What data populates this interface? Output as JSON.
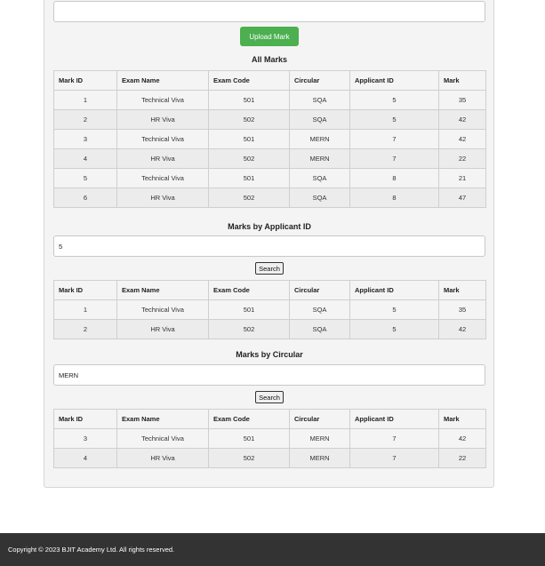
{
  "upload": {
    "button_label": "Upload Mark"
  },
  "columns": [
    "Mark ID",
    "Exam Name",
    "Exam Code",
    "Circular",
    "Applicant ID",
    "Mark"
  ],
  "all_marks": {
    "title": "All Marks",
    "rows": [
      [
        "1",
        "Technical Viva",
        "501",
        "SQA",
        "5",
        "35"
      ],
      [
        "2",
        "HR Viva",
        "502",
        "SQA",
        "5",
        "42"
      ],
      [
        "3",
        "Technical Viva",
        "501",
        "MERN",
        "7",
        "42"
      ],
      [
        "4",
        "HR Viva",
        "502",
        "MERN",
        "7",
        "22"
      ],
      [
        "5",
        "Technical Viva",
        "501",
        "SQA",
        "8",
        "21"
      ],
      [
        "6",
        "HR Viva",
        "502",
        "SQA",
        "8",
        "47"
      ]
    ]
  },
  "by_applicant": {
    "title": "Marks by Applicant ID",
    "input_value": "5",
    "search_label": "Search",
    "rows": [
      [
        "1",
        "Technical Viva",
        "501",
        "SQA",
        "5",
        "35"
      ],
      [
        "2",
        "HR Viva",
        "502",
        "SQA",
        "5",
        "42"
      ]
    ]
  },
  "by_circular": {
    "title": "Marks by Circular",
    "input_value": "MERN",
    "search_label": "Search",
    "rows": [
      [
        "3",
        "Technical Viva",
        "501",
        "MERN",
        "7",
        "42"
      ],
      [
        "4",
        "HR Viva",
        "502",
        "MERN",
        "7",
        "22"
      ]
    ]
  },
  "footer": {
    "text": "Copyright © 2023 BJIT Academy Ltd. All rights reserved."
  }
}
